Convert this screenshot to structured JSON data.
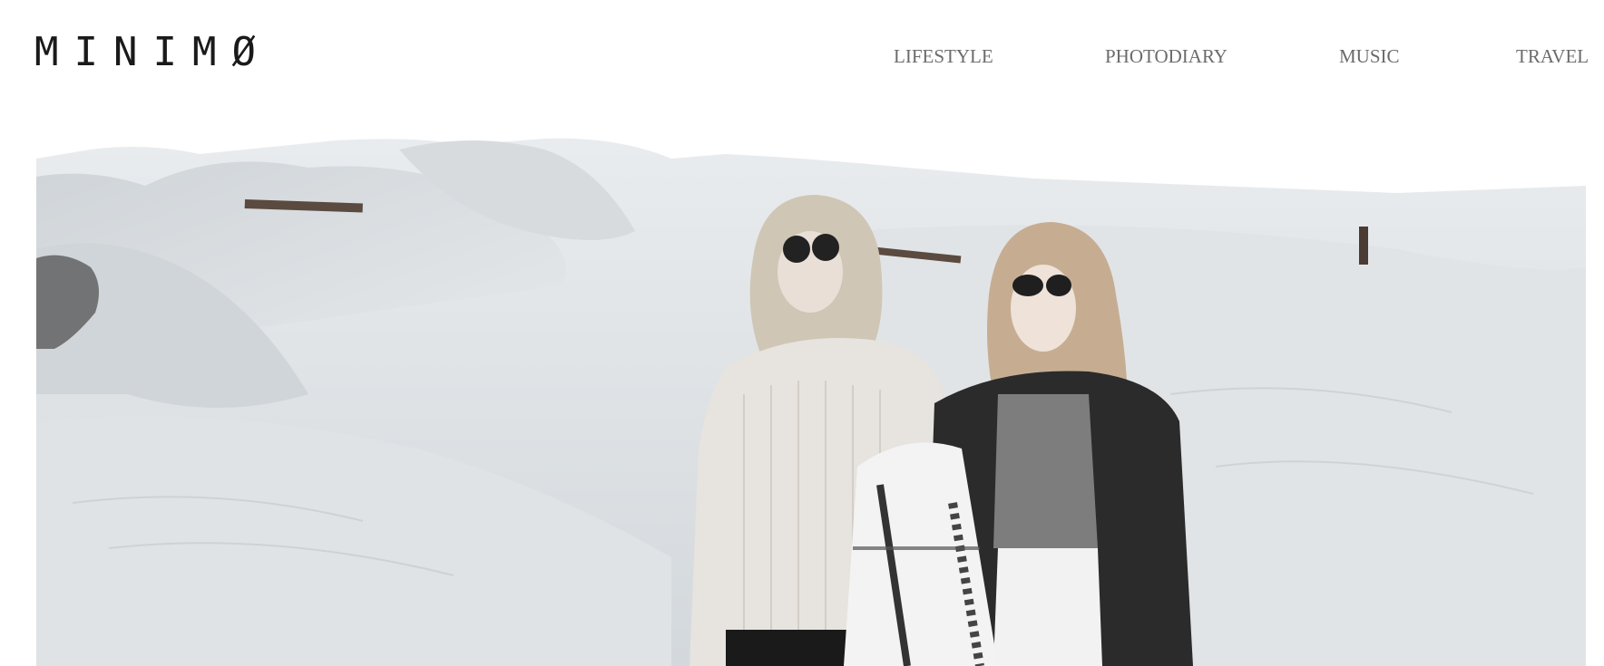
{
  "site": {
    "logo_text": "MINIMØ"
  },
  "nav": {
    "items": [
      {
        "label": "LIFESTYLE"
      },
      {
        "label": "PHOTODIARY"
      },
      {
        "label": "MUSIC"
      },
      {
        "label": "TRAVEL"
      }
    ]
  },
  "hero": {
    "image_icon": "photo-of-two-women-on-sand-dunes"
  },
  "colors": {
    "background": "#ffffff",
    "logo": "#1a1a1a",
    "nav_text": "#6b6b6b",
    "sand": "#dfe3e6"
  }
}
